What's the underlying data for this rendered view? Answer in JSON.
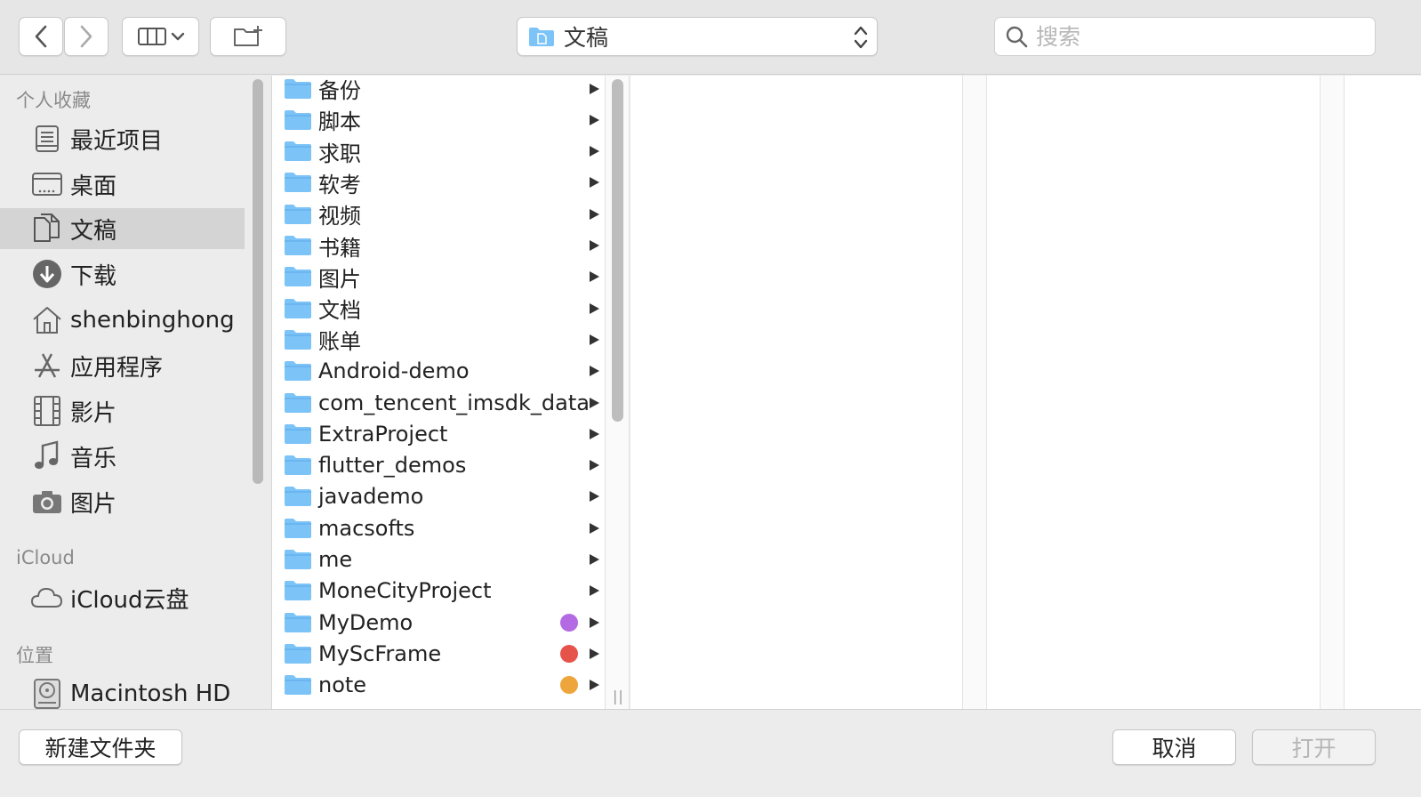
{
  "toolbar": {
    "path_label": "文稿",
    "search_placeholder": "搜索"
  },
  "sidebar": {
    "favorites_header": "个人收藏",
    "favorites": [
      {
        "label": "最近项目",
        "icon": "recents-icon"
      },
      {
        "label": "桌面",
        "icon": "desktop-icon"
      },
      {
        "label": "文稿",
        "icon": "documents-icon",
        "selected": true
      },
      {
        "label": "下载",
        "icon": "downloads-icon"
      },
      {
        "label": "shenbinghong",
        "icon": "home-icon"
      },
      {
        "label": "应用程序",
        "icon": "applications-icon"
      },
      {
        "label": "影片",
        "icon": "movies-icon"
      },
      {
        "label": "音乐",
        "icon": "music-icon"
      },
      {
        "label": "图片",
        "icon": "pictures-icon"
      }
    ],
    "icloud_header": "iCloud",
    "icloud_items": [
      {
        "label": "iCloud云盘",
        "icon": "cloud-icon"
      }
    ],
    "locations_header": "位置",
    "location_items": [
      {
        "label": "Macintosh HD",
        "icon": "harddisk-icon"
      }
    ]
  },
  "column1": {
    "items": [
      {
        "name": "备份"
      },
      {
        "name": "脚本"
      },
      {
        "name": "求职"
      },
      {
        "name": "软考"
      },
      {
        "name": "视频"
      },
      {
        "name": "书籍"
      },
      {
        "name": "图片"
      },
      {
        "name": "文档"
      },
      {
        "name": "账单"
      },
      {
        "name": "Android-demo"
      },
      {
        "name": "com_tencent_imsdk_data"
      },
      {
        "name": "ExtraProject"
      },
      {
        "name": "flutter_demos"
      },
      {
        "name": "javademo"
      },
      {
        "name": "macsofts"
      },
      {
        "name": "me"
      },
      {
        "name": "MoneCityProject"
      },
      {
        "name": "MyDemo",
        "tag_color": "#b36ae2"
      },
      {
        "name": "MyScFrame",
        "tag_color": "#e5534b"
      },
      {
        "name": "note",
        "tag_color": "#eea53b"
      }
    ]
  },
  "footer": {
    "new_folder_label": "新建文件夹",
    "cancel_label": "取消",
    "open_label": "打开"
  },
  "colors": {
    "folder_blue": "#7cc3f7",
    "selection_gray": "#d4d4d4"
  }
}
